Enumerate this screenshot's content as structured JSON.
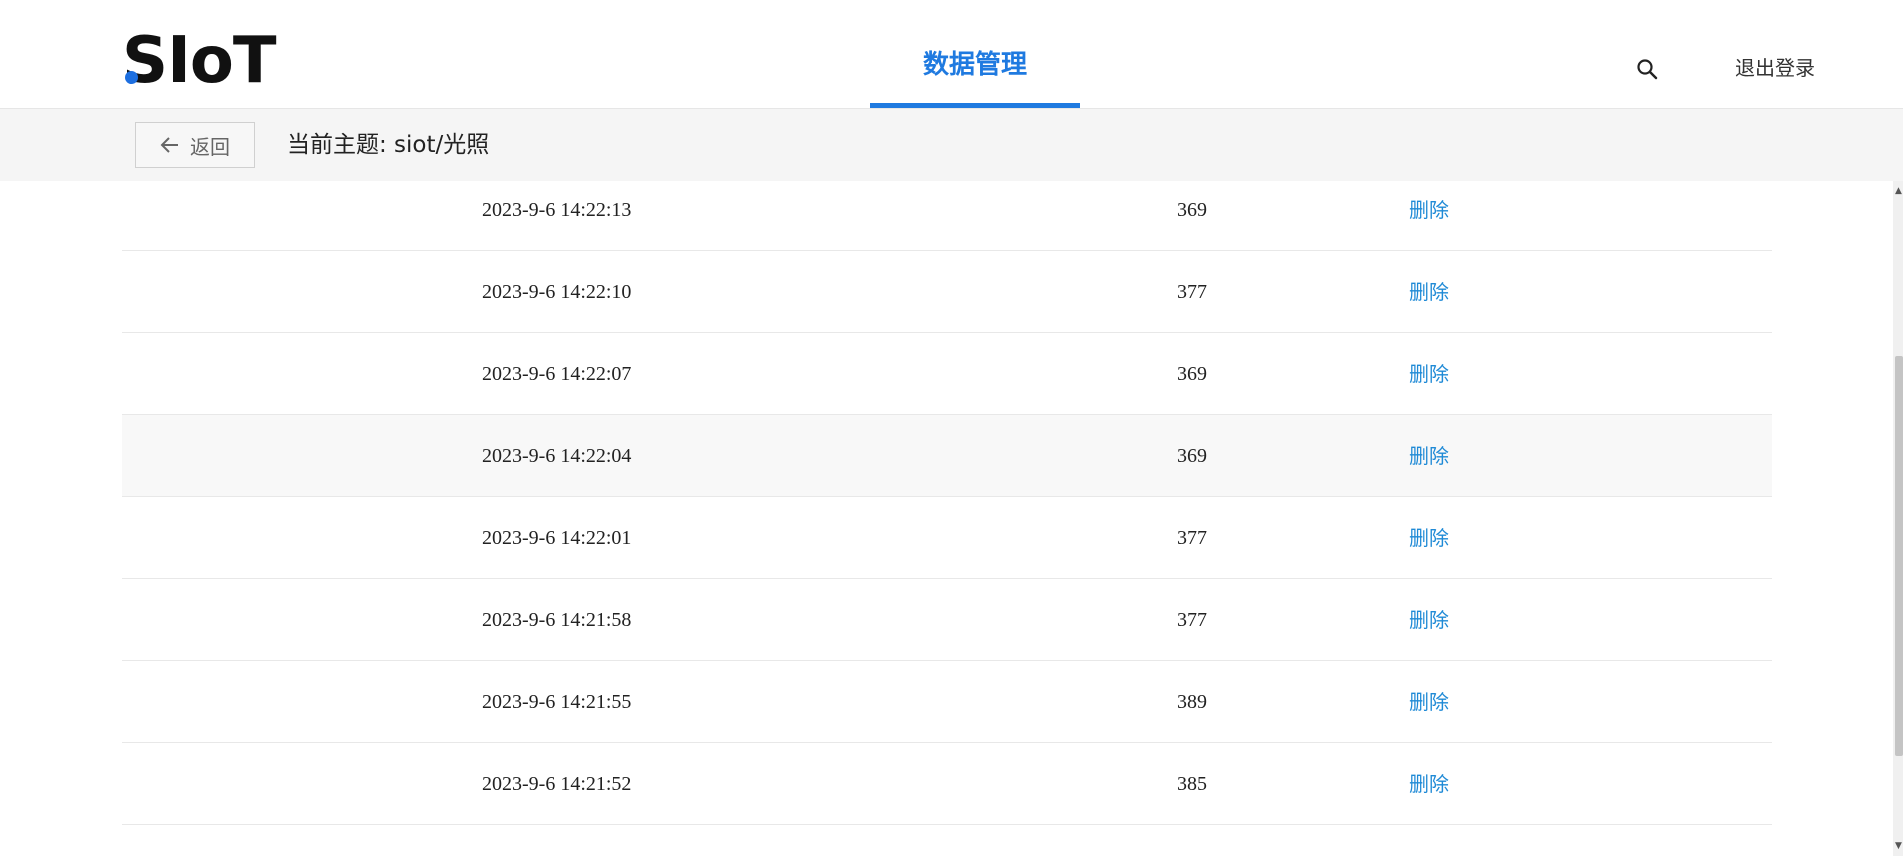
{
  "header": {
    "logo_text": "SIoT",
    "nav_tab": "数据管理",
    "search_icon": "search-icon",
    "logout_label": "退出登录",
    "accent_color": "#1f7ae0"
  },
  "subbar": {
    "back_label": "返回",
    "topic_label": "当前主题: siot/光照"
  },
  "table": {
    "rows": [
      {
        "time": "2023-9-6 14:22:13",
        "value": "369",
        "action": "删除"
      },
      {
        "time": "2023-9-6 14:22:10",
        "value": "377",
        "action": "删除"
      },
      {
        "time": "2023-9-6 14:22:07",
        "value": "369",
        "action": "删除"
      },
      {
        "time": "2023-9-6 14:22:04",
        "value": "369",
        "action": "删除"
      },
      {
        "time": "2023-9-6 14:22:01",
        "value": "377",
        "action": "删除"
      },
      {
        "time": "2023-9-6 14:21:58",
        "value": "377",
        "action": "删除"
      },
      {
        "time": "2023-9-6 14:21:55",
        "value": "389",
        "action": "删除"
      },
      {
        "time": "2023-9-6 14:21:52",
        "value": "385",
        "action": "删除"
      }
    ]
  }
}
